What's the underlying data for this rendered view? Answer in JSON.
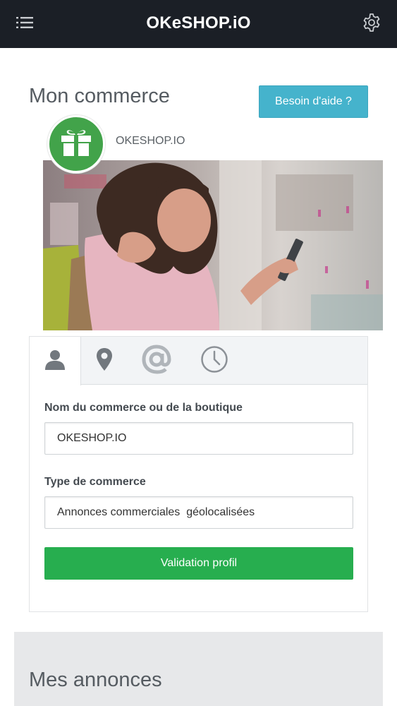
{
  "app": {
    "brand": "OKeSHOP.iO"
  },
  "icons": {
    "menu": "list-menu-icon",
    "settings": "gear-icon",
    "logo": "gift-icon",
    "tabs": [
      "user-icon",
      "map-pin-icon",
      "at-sign-icon",
      "clock-icon"
    ]
  },
  "header": {
    "title": "Mon commerce",
    "help_label": "Besoin d'aide ?"
  },
  "shop": {
    "name": "OKESHOP.IO"
  },
  "form": {
    "name_label": "Nom du commerce ou de la boutique",
    "name_value": "OKESHOP.IO",
    "type_label": "Type de commerce",
    "type_value": "Annonces commerciales  géolocalisées",
    "submit_label": "Validation profil"
  },
  "ads": {
    "title": "Mes annonces"
  },
  "colors": {
    "topbar": "#1b1f26",
    "help_button": "#45b3cc",
    "logo": "#42a34a",
    "submit_button": "#27ae4f"
  }
}
